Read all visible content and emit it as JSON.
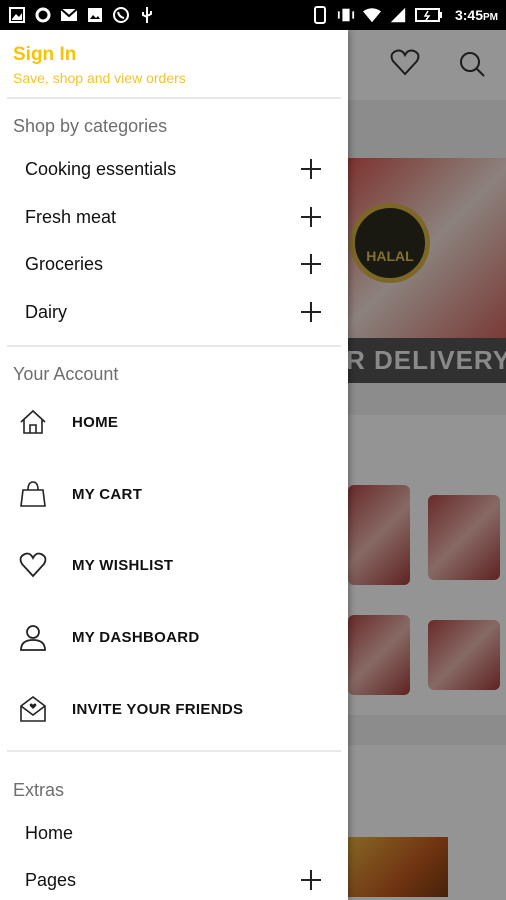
{
  "status_bar": {
    "time": "3:45",
    "time_suffix": "PM",
    "left_icons": [
      "gallery-icon",
      "circle-app-icon",
      "mail-icon",
      "image-icon",
      "whatsapp-icon",
      "usb-icon"
    ],
    "right_icons": [
      "phone-icon",
      "vibrate-icon",
      "wifi-icon",
      "signal-icon",
      "battery-icon"
    ]
  },
  "background": {
    "banner_badge": "HALAL",
    "banner_text": "R DELIVERY",
    "chevron": "»"
  },
  "drawer": {
    "sign_in": {
      "title": "Sign In",
      "subtitle": "Save, shop and view orders"
    },
    "categories": {
      "title": "Shop by categories",
      "items": [
        {
          "label": "Cooking essentials"
        },
        {
          "label": "Fresh meat"
        },
        {
          "label": "Groceries"
        },
        {
          "label": "Dairy"
        }
      ]
    },
    "account": {
      "title": "Your Account",
      "items": [
        {
          "label": "HOME",
          "icon": "home-icon"
        },
        {
          "label": "MY CART",
          "icon": "shopping-bag-icon"
        },
        {
          "label": "MY WISHLIST",
          "icon": "heart-icon"
        },
        {
          "label": "MY DASHBOARD",
          "icon": "user-icon"
        },
        {
          "label": "INVITE YOUR FRIENDS",
          "icon": "invite-envelope-icon"
        }
      ]
    },
    "extras": {
      "title": "Extras",
      "items": [
        {
          "label": "Home"
        },
        {
          "label": "Pages"
        }
      ]
    }
  },
  "colors": {
    "accent": "#f7c500",
    "section_title": "#6e6e6e",
    "text": "#111111"
  }
}
